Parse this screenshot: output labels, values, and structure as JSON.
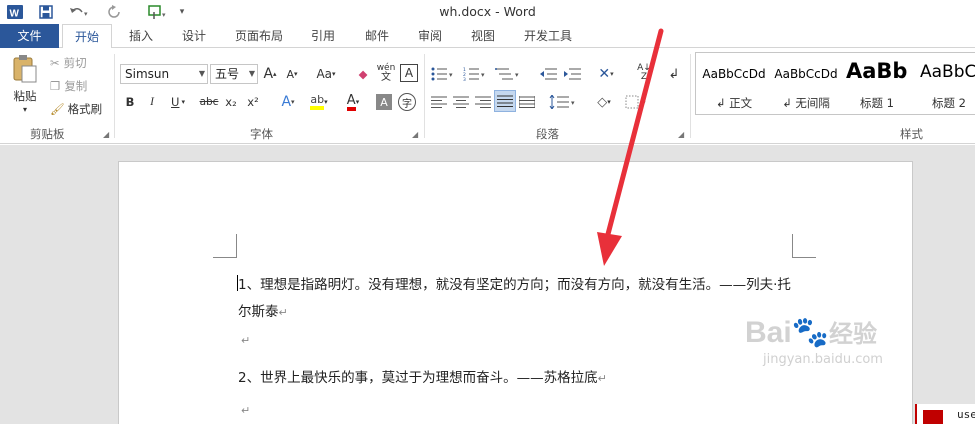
{
  "window": {
    "title": "wh.docx - Word"
  },
  "quick_access": {
    "customize_glyph": "▾"
  },
  "tabs": [
    "文件",
    "开始",
    "插入",
    "设计",
    "页面布局",
    "引用",
    "邮件",
    "审阅",
    "视图",
    "开发工具"
  ],
  "clipboard": {
    "paste": "粘贴",
    "cut": "剪切",
    "copy": "复制",
    "format_painter": "格式刷",
    "group": "剪贴板"
  },
  "font": {
    "name": "Simsun",
    "size": "五号",
    "grow": "A",
    "shrink": "A",
    "change_case": "Aa",
    "phonetic": "wén",
    "bold": "B",
    "italic": "I",
    "underline": "U",
    "strike": "abc",
    "subscript": "x₂",
    "superscript": "x²",
    "text_effect": "A",
    "font_color": "A",
    "char_shading": "A",
    "enclose": "字",
    "group": "字体"
  },
  "paragraph": {
    "group": "段落"
  },
  "styles": {
    "items": [
      {
        "sample": "AaBbCcDd",
        "name": "↲ 正文"
      },
      {
        "sample": "AaBbCcDd",
        "name": "↲ 无间隔"
      },
      {
        "sample": "AaBb",
        "name": "标题 1"
      },
      {
        "sample": "AaBbC",
        "name": "标题 2"
      }
    ],
    "group": "样式"
  },
  "document": {
    "paragraphs": [
      {
        "text": "1、理想是指路明灯。没有理想，就没有坚定的方向；而没有方向，就没有生活。——列夫·托"
      },
      {
        "text": "尔斯泰",
        "mark": "↵"
      },
      {
        "text": "",
        "mark": "↵"
      },
      {
        "text": "2、世界上最快乐的事，莫过于为理想而奋斗。——苏格拉底",
        "mark": "↵"
      },
      {
        "text": "",
        "mark": "↵"
      }
    ]
  },
  "watermark": {
    "logo": "Bai",
    "logo2": "经验",
    "url": "jingyan.baidu.com"
  },
  "user_badge": {
    "text": "use"
  },
  "colors": {
    "accent": "#2b579a",
    "arrow": "#e8303a",
    "highlight": "#ffff00",
    "font_color": "#e00000"
  }
}
